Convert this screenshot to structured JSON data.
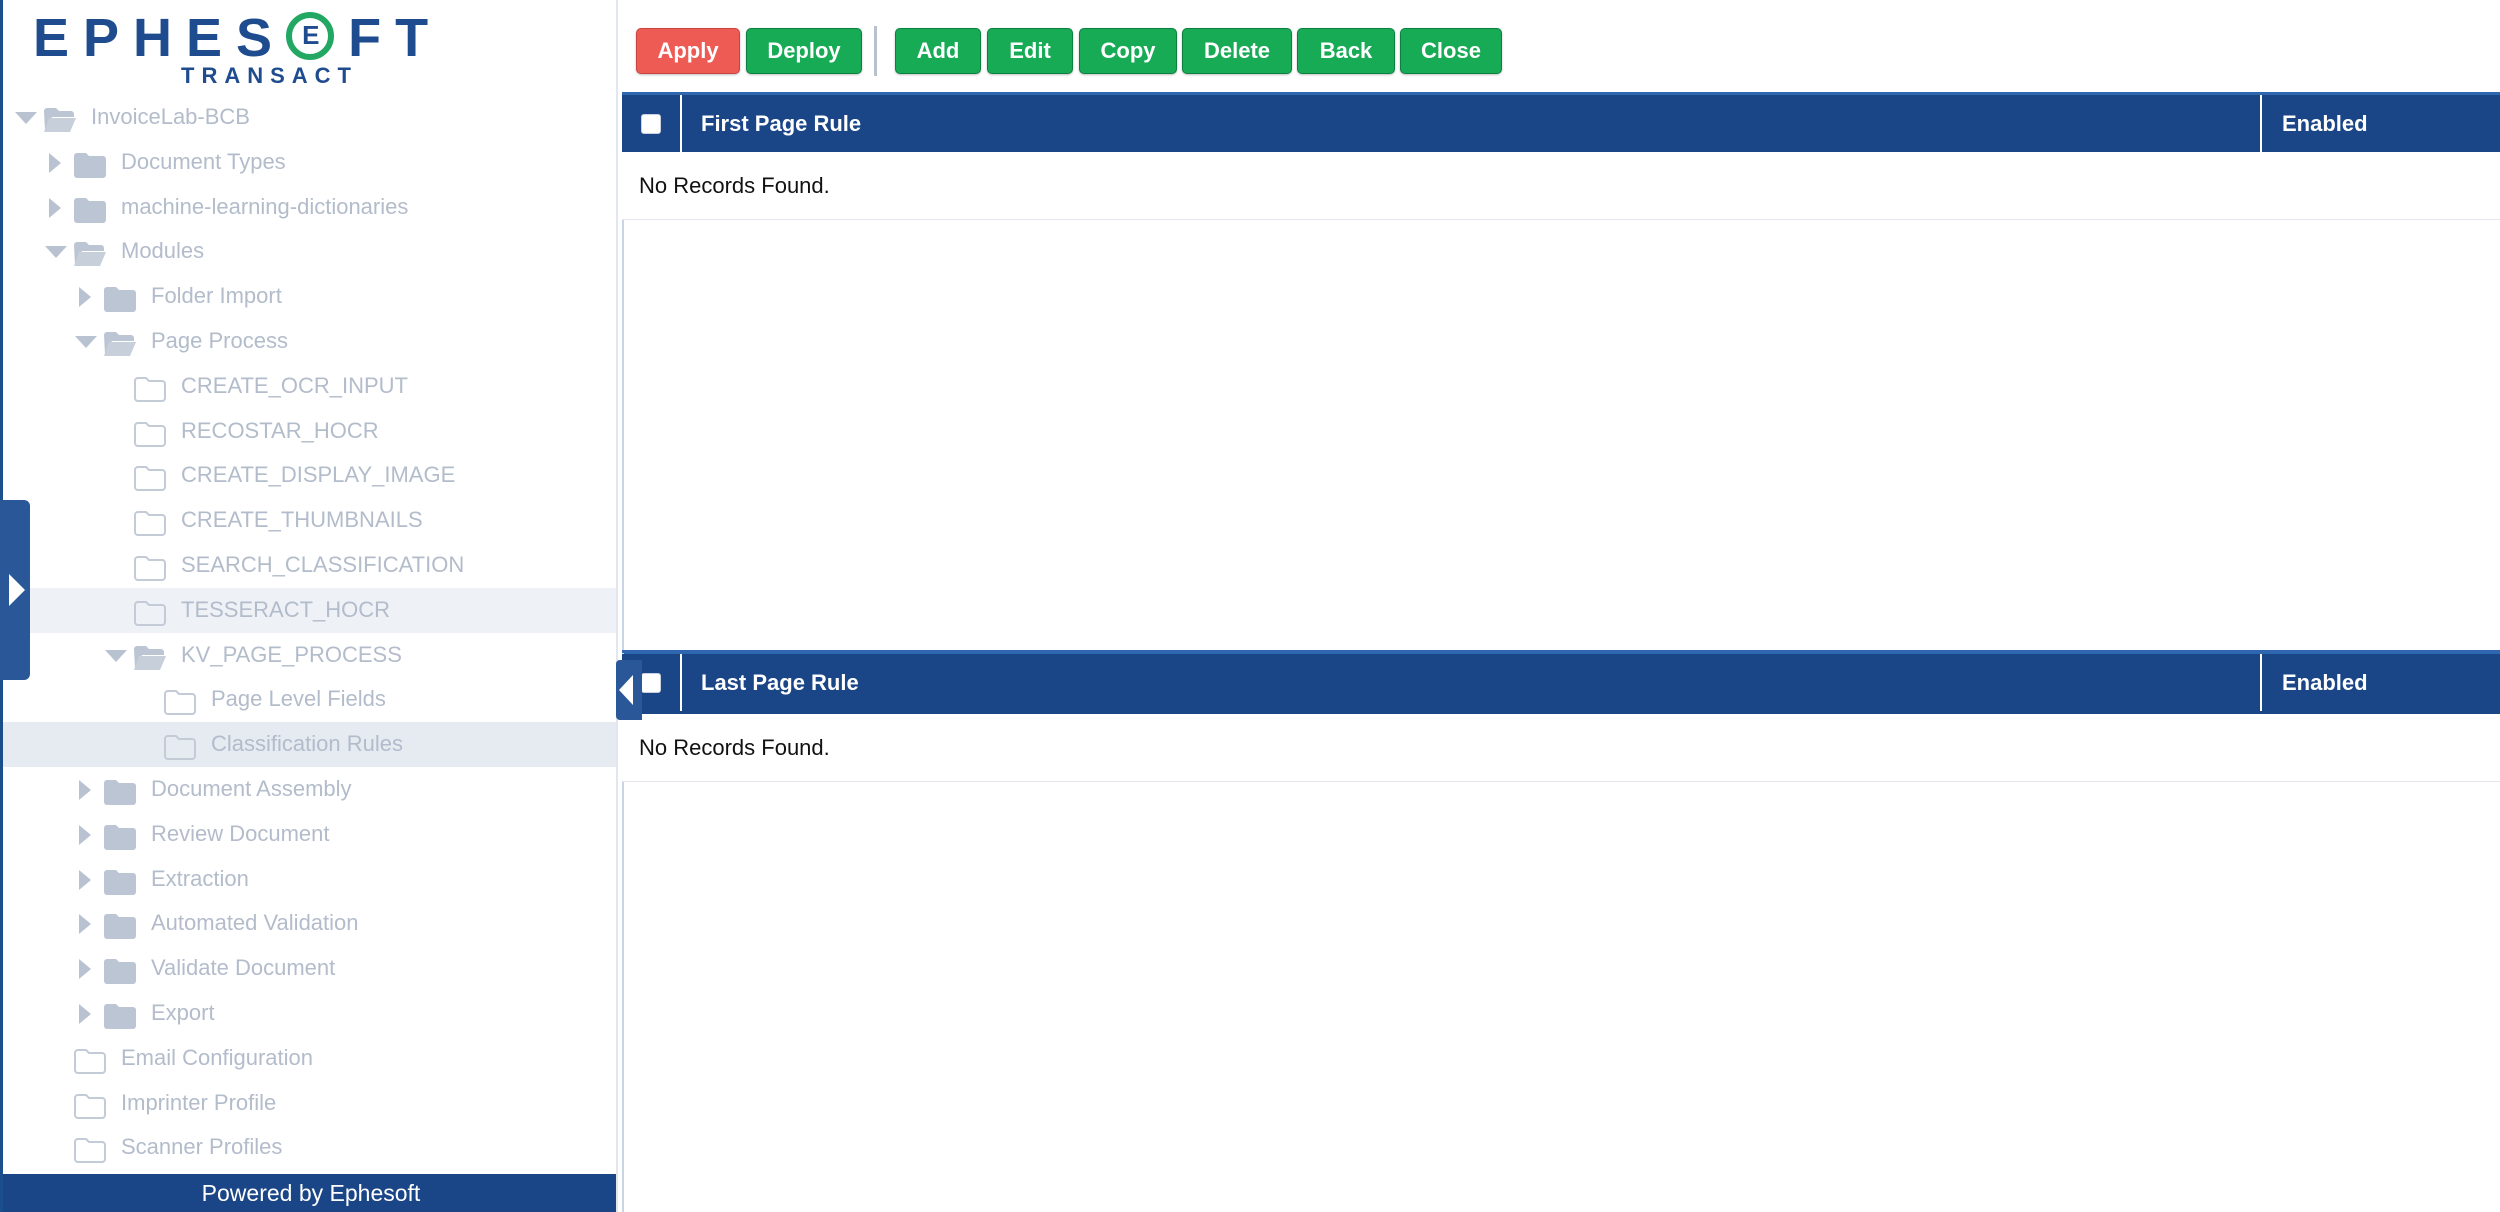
{
  "branding": {
    "logo_main": "EPHES FT",
    "logo_sub": "TRANSACT",
    "footer": "Powered by Ephesoft"
  },
  "colors": {
    "brand_blue": "#1a4586",
    "button_green": "#17ab56",
    "button_red": "#ee5b55",
    "tree_text": "#b3bccb"
  },
  "toolbar": {
    "apply": "Apply",
    "deploy": "Deploy",
    "add": "Add",
    "edit": "Edit",
    "copy": "Copy",
    "delete": "Delete",
    "back": "Back",
    "close": "Close"
  },
  "tree": [
    {
      "label": "InvoiceLab-BCB",
      "level": 0,
      "toggle": "expanded",
      "icon": "folder-open-icon"
    },
    {
      "label": "Document Types",
      "level": 1,
      "toggle": "collapsed",
      "icon": "folder-icon"
    },
    {
      "label": "machine-learning-dictionaries",
      "level": 1,
      "toggle": "collapsed",
      "icon": "folder-icon"
    },
    {
      "label": "Modules",
      "level": 1,
      "toggle": "expanded",
      "icon": "folder-open-icon"
    },
    {
      "label": "Folder Import",
      "level": 2,
      "toggle": "collapsed",
      "icon": "folder-icon"
    },
    {
      "label": "Page Process",
      "level": 2,
      "toggle": "expanded",
      "icon": "folder-open-icon"
    },
    {
      "label": "CREATE_OCR_INPUT",
      "level": 3,
      "toggle": "none",
      "icon": "folder-outline-icon"
    },
    {
      "label": "RECOSTAR_HOCR",
      "level": 3,
      "toggle": "none",
      "icon": "folder-outline-icon"
    },
    {
      "label": "CREATE_DISPLAY_IMAGE",
      "level": 3,
      "toggle": "none",
      "icon": "folder-outline-icon"
    },
    {
      "label": "CREATE_THUMBNAILS",
      "level": 3,
      "toggle": "none",
      "icon": "folder-outline-icon"
    },
    {
      "label": "SEARCH_CLASSIFICATION",
      "level": 3,
      "toggle": "none",
      "icon": "folder-outline-icon"
    },
    {
      "label": "TESSERACT_HOCR",
      "level": 3,
      "toggle": "none",
      "icon": "folder-outline-icon",
      "state": "hover"
    },
    {
      "label": "KV_PAGE_PROCESS",
      "level": 3,
      "toggle": "expanded",
      "icon": "folder-open-icon"
    },
    {
      "label": "Page Level Fields",
      "level": 4,
      "toggle": "none",
      "icon": "folder-outline-icon"
    },
    {
      "label": "Classification Rules",
      "level": 4,
      "toggle": "none",
      "icon": "folder-outline-icon",
      "state": "selected"
    },
    {
      "label": "Document Assembly",
      "level": 2,
      "toggle": "collapsed",
      "icon": "folder-icon"
    },
    {
      "label": "Review Document",
      "level": 2,
      "toggle": "collapsed",
      "icon": "folder-icon"
    },
    {
      "label": "Extraction",
      "level": 2,
      "toggle": "collapsed",
      "icon": "folder-icon"
    },
    {
      "label": "Automated Validation",
      "level": 2,
      "toggle": "collapsed",
      "icon": "folder-icon"
    },
    {
      "label": "Validate Document",
      "level": 2,
      "toggle": "collapsed",
      "icon": "folder-icon"
    },
    {
      "label": "Export",
      "level": 2,
      "toggle": "collapsed",
      "icon": "folder-icon"
    },
    {
      "label": "Email Configuration",
      "level": 1,
      "toggle": "none",
      "icon": "folder-outline-icon"
    },
    {
      "label": "Imprinter Profile",
      "level": 1,
      "toggle": "none",
      "icon": "folder-outline-icon"
    },
    {
      "label": "Scanner Profiles",
      "level": 1,
      "toggle": "none",
      "icon": "folder-outline-icon"
    }
  ],
  "grids": {
    "first": {
      "column_rule": "First Page Rule",
      "column_enabled": "Enabled",
      "empty_text": "No Records Found."
    },
    "last": {
      "column_rule": "Last Page Rule",
      "column_enabled": "Enabled",
      "empty_text": "No Records Found."
    }
  }
}
